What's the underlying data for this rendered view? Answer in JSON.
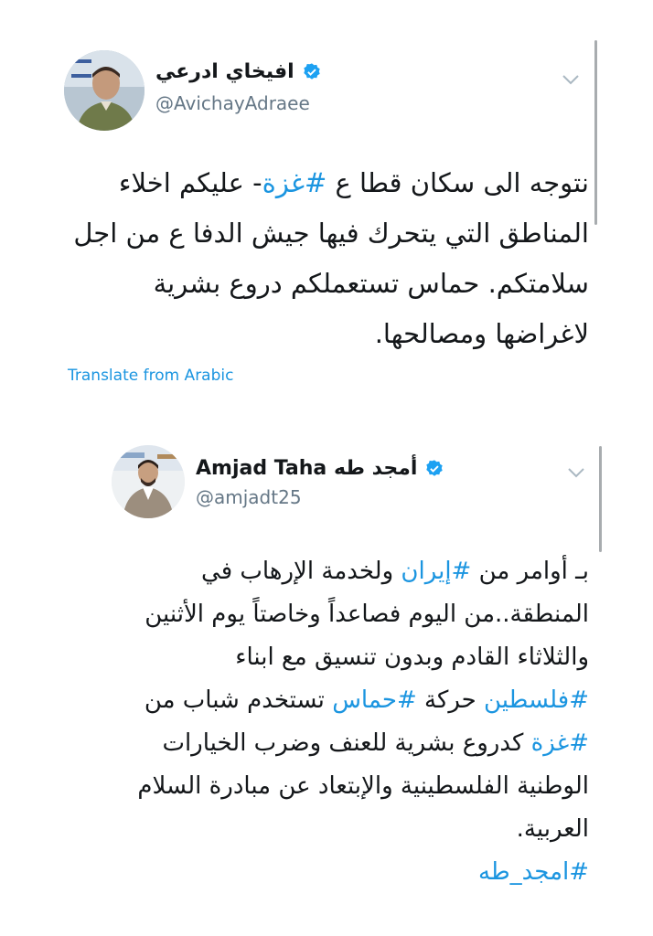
{
  "tweets": [
    {
      "name": "افيخاي ادرعي",
      "handle": "@AvichayAdraee",
      "lines": [
        [
          {
            "t": "نتوجه الى سكان قطا ع "
          },
          {
            "t": "#غزة",
            "tag": true
          },
          {
            "t": "- عليكم اخلاء"
          }
        ],
        [
          {
            "t": "المناطق التي يتحرك فيها جيش الدفا ع من اجل"
          }
        ],
        [
          {
            "t": "سلامتكم. حماس تستعملكم دروع بشرية"
          }
        ],
        [
          {
            "t": "لاغراضها ومصالحها."
          }
        ]
      ],
      "translate_label": "Translate from Arabic"
    },
    {
      "name": "Amjad Taha أمجد طه",
      "handle": "@amjadt25",
      "lines": [
        [
          {
            "t": "بـ أوامر من "
          },
          {
            "t": "#إيران",
            "tag": true
          },
          {
            "t": " ولخدمة الإرهاب في"
          }
        ],
        [
          {
            "t": "المنطقة..من اليوم فصاعداً وخاصتاً يوم الأثنين"
          }
        ],
        [
          {
            "t": "والثلاثاء القادم وبدون تنسيق مع ابناء"
          }
        ],
        [
          {
            "t": "#فلسطين",
            "tag": true
          },
          {
            "t": " حركة "
          },
          {
            "t": "#حماس",
            "tag": true
          },
          {
            "t": " تستخدم شباب من"
          }
        ],
        [
          {
            "t": "#غزة",
            "tag": true
          },
          {
            "t": " كدروع بشرية للعنف وضرب الخيارات"
          }
        ],
        [
          {
            "t": "الوطنية الفلسطينية والإبتعاد عن مبادرة السلام"
          }
        ],
        [
          {
            "t": "العربية."
          }
        ],
        [
          {
            "t": "#امجد_طه",
            "tag": true
          }
        ]
      ]
    }
  ],
  "colors": {
    "text": "#14171a",
    "secondary": "#657786",
    "link": "#1b95e0",
    "verified": "#1da1f2"
  },
  "icons": [
    "avatar",
    "verified-badge-icon",
    "chevron-down-icon"
  ]
}
